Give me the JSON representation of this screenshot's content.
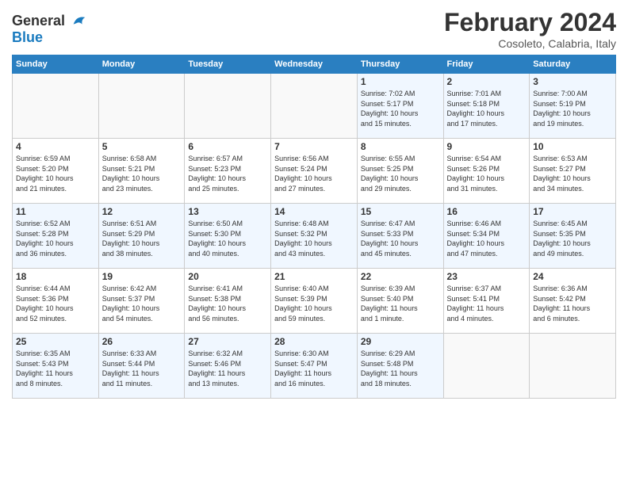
{
  "header": {
    "logo_line1": "General",
    "logo_line2": "Blue",
    "title": "February 2024",
    "location": "Cosoleto, Calabria, Italy"
  },
  "calendar": {
    "weekdays": [
      "Sunday",
      "Monday",
      "Tuesday",
      "Wednesday",
      "Thursday",
      "Friday",
      "Saturday"
    ],
    "weeks": [
      {
        "days": [
          {
            "number": "",
            "info": ""
          },
          {
            "number": "",
            "info": ""
          },
          {
            "number": "",
            "info": ""
          },
          {
            "number": "",
            "info": ""
          },
          {
            "number": "1",
            "info": "Sunrise: 7:02 AM\nSunset: 5:17 PM\nDaylight: 10 hours\nand 15 minutes."
          },
          {
            "number": "2",
            "info": "Sunrise: 7:01 AM\nSunset: 5:18 PM\nDaylight: 10 hours\nand 17 minutes."
          },
          {
            "number": "3",
            "info": "Sunrise: 7:00 AM\nSunset: 5:19 PM\nDaylight: 10 hours\nand 19 minutes."
          }
        ]
      },
      {
        "days": [
          {
            "number": "4",
            "info": "Sunrise: 6:59 AM\nSunset: 5:20 PM\nDaylight: 10 hours\nand 21 minutes."
          },
          {
            "number": "5",
            "info": "Sunrise: 6:58 AM\nSunset: 5:21 PM\nDaylight: 10 hours\nand 23 minutes."
          },
          {
            "number": "6",
            "info": "Sunrise: 6:57 AM\nSunset: 5:23 PM\nDaylight: 10 hours\nand 25 minutes."
          },
          {
            "number": "7",
            "info": "Sunrise: 6:56 AM\nSunset: 5:24 PM\nDaylight: 10 hours\nand 27 minutes."
          },
          {
            "number": "8",
            "info": "Sunrise: 6:55 AM\nSunset: 5:25 PM\nDaylight: 10 hours\nand 29 minutes."
          },
          {
            "number": "9",
            "info": "Sunrise: 6:54 AM\nSunset: 5:26 PM\nDaylight: 10 hours\nand 31 minutes."
          },
          {
            "number": "10",
            "info": "Sunrise: 6:53 AM\nSunset: 5:27 PM\nDaylight: 10 hours\nand 34 minutes."
          }
        ]
      },
      {
        "days": [
          {
            "number": "11",
            "info": "Sunrise: 6:52 AM\nSunset: 5:28 PM\nDaylight: 10 hours\nand 36 minutes."
          },
          {
            "number": "12",
            "info": "Sunrise: 6:51 AM\nSunset: 5:29 PM\nDaylight: 10 hours\nand 38 minutes."
          },
          {
            "number": "13",
            "info": "Sunrise: 6:50 AM\nSunset: 5:30 PM\nDaylight: 10 hours\nand 40 minutes."
          },
          {
            "number": "14",
            "info": "Sunrise: 6:48 AM\nSunset: 5:32 PM\nDaylight: 10 hours\nand 43 minutes."
          },
          {
            "number": "15",
            "info": "Sunrise: 6:47 AM\nSunset: 5:33 PM\nDaylight: 10 hours\nand 45 minutes."
          },
          {
            "number": "16",
            "info": "Sunrise: 6:46 AM\nSunset: 5:34 PM\nDaylight: 10 hours\nand 47 minutes."
          },
          {
            "number": "17",
            "info": "Sunrise: 6:45 AM\nSunset: 5:35 PM\nDaylight: 10 hours\nand 49 minutes."
          }
        ]
      },
      {
        "days": [
          {
            "number": "18",
            "info": "Sunrise: 6:44 AM\nSunset: 5:36 PM\nDaylight: 10 hours\nand 52 minutes."
          },
          {
            "number": "19",
            "info": "Sunrise: 6:42 AM\nSunset: 5:37 PM\nDaylight: 10 hours\nand 54 minutes."
          },
          {
            "number": "20",
            "info": "Sunrise: 6:41 AM\nSunset: 5:38 PM\nDaylight: 10 hours\nand 56 minutes."
          },
          {
            "number": "21",
            "info": "Sunrise: 6:40 AM\nSunset: 5:39 PM\nDaylight: 10 hours\nand 59 minutes."
          },
          {
            "number": "22",
            "info": "Sunrise: 6:39 AM\nSunset: 5:40 PM\nDaylight: 11 hours\nand 1 minute."
          },
          {
            "number": "23",
            "info": "Sunrise: 6:37 AM\nSunset: 5:41 PM\nDaylight: 11 hours\nand 4 minutes."
          },
          {
            "number": "24",
            "info": "Sunrise: 6:36 AM\nSunset: 5:42 PM\nDaylight: 11 hours\nand 6 minutes."
          }
        ]
      },
      {
        "days": [
          {
            "number": "25",
            "info": "Sunrise: 6:35 AM\nSunset: 5:43 PM\nDaylight: 11 hours\nand 8 minutes."
          },
          {
            "number": "26",
            "info": "Sunrise: 6:33 AM\nSunset: 5:44 PM\nDaylight: 11 hours\nand 11 minutes."
          },
          {
            "number": "27",
            "info": "Sunrise: 6:32 AM\nSunset: 5:46 PM\nDaylight: 11 hours\nand 13 minutes."
          },
          {
            "number": "28",
            "info": "Sunrise: 6:30 AM\nSunset: 5:47 PM\nDaylight: 11 hours\nand 16 minutes."
          },
          {
            "number": "29",
            "info": "Sunrise: 6:29 AM\nSunset: 5:48 PM\nDaylight: 11 hours\nand 18 minutes."
          },
          {
            "number": "",
            "info": ""
          },
          {
            "number": "",
            "info": ""
          }
        ]
      }
    ]
  }
}
